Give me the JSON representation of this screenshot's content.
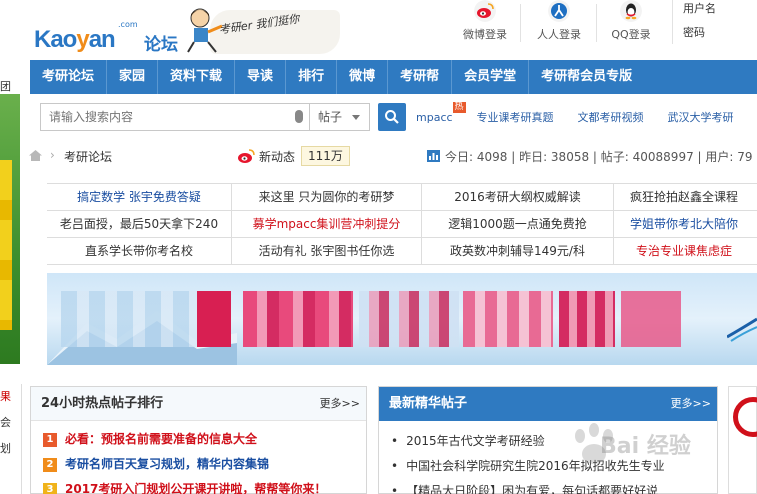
{
  "logo": {
    "brand_prefix": "Kao",
    "brand_y": "y",
    "brand_suffix": "an",
    "com": ".com",
    "forum_cn": "论坛",
    "slogan": "考研er 我们挺你"
  },
  "login": {
    "weibo": "微博登录",
    "renren": "人人登录",
    "qq": "QQ登录",
    "username_label": "用户名",
    "password_label": "密码"
  },
  "nav": [
    "考研论坛",
    "家园",
    "资料下载",
    "导读",
    "排行",
    "微博",
    "考研帮",
    "会员学堂",
    "考研帮会员专版"
  ],
  "search": {
    "placeholder": "请输入搜索内容",
    "scope": "帖子"
  },
  "quick_links": [
    {
      "label": "mpacc",
      "badge": "热"
    },
    {
      "label": "专业课考研真题"
    },
    {
      "label": "文都考研视频"
    },
    {
      "label": "武汉大学考研"
    }
  ],
  "breadcrumb": {
    "current": "考研论坛"
  },
  "news": {
    "label": "新动态",
    "count": "111万"
  },
  "stats": {
    "text": "今日: 4098  |  昨日: 38058  |  帖子: 40088997  |  用户: 79"
  },
  "ad_rows": [
    [
      {
        "text": "搞定数学 张宇免费答疑",
        "color": "blue"
      },
      {
        "text": "来这里 只为圆你的考研梦",
        "color": "black"
      },
      {
        "text": "2016考研大纲权威解读",
        "color": "black"
      },
      {
        "text": "疯狂抢拍赵鑫全课程",
        "color": "black"
      }
    ],
    [
      {
        "text": "老吕面授，最后50天拿下240",
        "color": "black"
      },
      {
        "text": "募学mpacc集训营冲刺提分",
        "color": "red"
      },
      {
        "text": "逻辑1000题一点通免费抢",
        "color": "black"
      },
      {
        "text": "学姐带你考北大陪你",
        "color": "blue"
      }
    ],
    [
      {
        "text": "直系学长带你考名校",
        "color": "black"
      },
      {
        "text": "活动有礼 张宇图书任你选",
        "color": "black"
      },
      {
        "text": "政英数冲刺辅导149元/科",
        "color": "black"
      },
      {
        "text": "专治专业课焦虑症",
        "color": "red"
      }
    ]
  ],
  "left_strip": {
    "top_char": "团",
    "bottom_chars": [
      "果",
      "会",
      "划"
    ]
  },
  "hot_panel": {
    "title": "24小时热点帖子排行",
    "more": "更多>>",
    "items": [
      {
        "rank": "1",
        "text": "必看：预报名前需要准备的信息大全",
        "color": "red"
      },
      {
        "rank": "2",
        "text": "考研名师百天复习规划，精华内容集锦",
        "color": "blue"
      },
      {
        "rank": "3",
        "text": "2017考研入门规划公开课开讲啦，帮帮等你来！",
        "color": "red"
      }
    ]
  },
  "essence_panel": {
    "title": "最新精华帖子",
    "more": "更多>>",
    "items": [
      "2015年古代文学考研经验",
      "中国社会科学院研究生院2016年拟招收先生专业",
      "【精品大日阶段】困为有爱，每句话都要好好说"
    ]
  },
  "watermark": {
    "text": "Bai 经验"
  },
  "colors": {
    "nav_blue": "#2f7ac1",
    "link_blue": "#1a4ea1",
    "link_red": "#d0101a",
    "accent_orange": "#f08c1a"
  }
}
